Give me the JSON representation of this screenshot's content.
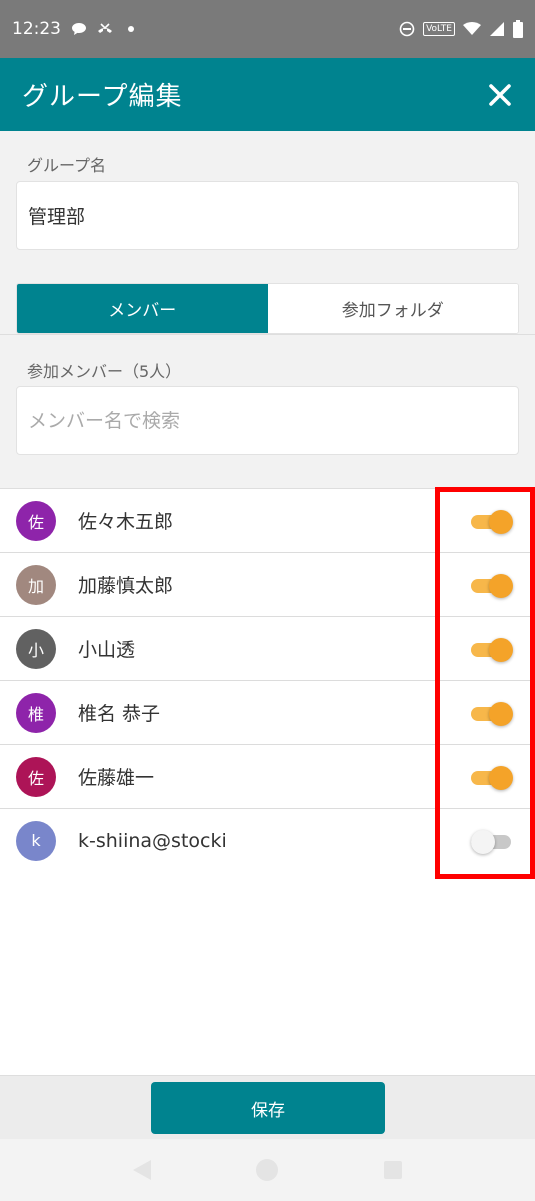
{
  "status_bar": {
    "time": "12:23",
    "volte_label": "VoLTE",
    "icons": [
      "chat-bubble-icon",
      "missed-call-icon",
      "notification-dot-icon",
      "do-not-disturb-icon",
      "volte-icon",
      "wifi-icon",
      "signal-icon",
      "battery-icon"
    ]
  },
  "header": {
    "title": "グループ編集",
    "close_icon": "close-icon"
  },
  "group_name": {
    "label": "グループ名",
    "value": "管理部"
  },
  "tabs": [
    {
      "label": "メンバー",
      "active": true
    },
    {
      "label": "参加フォルダ",
      "active": false
    }
  ],
  "members_section": {
    "label": "参加メンバー（5人）",
    "search_placeholder": "メンバー名で検索"
  },
  "members": [
    {
      "initial": "佐",
      "name": "佐々木五郎",
      "color": "#8e24aa",
      "enabled": true
    },
    {
      "initial": "加",
      "name": "加藤慎太郎",
      "color": "#a1887f",
      "enabled": true
    },
    {
      "initial": "小",
      "name": "小山透",
      "color": "#616161",
      "enabled": true
    },
    {
      "initial": "椎",
      "name": "椎名 恭子",
      "color": "#8e24aa",
      "enabled": true
    },
    {
      "initial": "佐",
      "name": "佐藤雄一",
      "color": "#ad1457",
      "enabled": true
    },
    {
      "initial": "k",
      "name": "k-shiina@stocki",
      "color": "#7986cb",
      "enabled": false
    }
  ],
  "footer": {
    "save_label": "保存"
  },
  "colors": {
    "primary": "#00838f",
    "toggle_on": "#f4a329",
    "highlight": "#ff0000"
  }
}
